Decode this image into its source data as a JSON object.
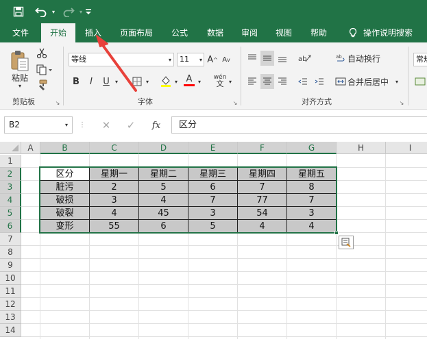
{
  "quick_access": {
    "save_icon": "save-icon",
    "undo_icon": "undo-icon",
    "redo_icon": "redo-icon",
    "customize_icon": "customize-qat-icon"
  },
  "menu": {
    "items": [
      "文件",
      "开始",
      "插入",
      "页面布局",
      "公式",
      "数据",
      "审阅",
      "视图",
      "帮助"
    ],
    "active": "开始",
    "tell_me": "操作说明搜索"
  },
  "ribbon": {
    "clipboard": {
      "paste_label": "粘贴",
      "group_label": "剪贴板"
    },
    "font": {
      "font_name": "等线",
      "font_size": "11",
      "bold": "B",
      "italic": "I",
      "underline": "U",
      "font_color": "A",
      "phonetic": "wén",
      "grow": "A",
      "shrink": "A",
      "group_label": "字体",
      "highlight_color": "#ffff00",
      "font_color_value": "#ff0000"
    },
    "alignment": {
      "wrap_text": "自动换行",
      "merge_center": "合并后居中",
      "group_label": "对齐方式"
    },
    "number": {
      "format": "常规"
    }
  },
  "formula_bar": {
    "name_box": "B2",
    "fx": "fx",
    "content": "区分"
  },
  "sheet": {
    "columns": [
      "A",
      "B",
      "C",
      "D",
      "E",
      "F",
      "G",
      "H",
      "I"
    ],
    "selected_columns": [
      "B",
      "C",
      "D",
      "E",
      "F",
      "G"
    ],
    "rows": [
      "1",
      "2",
      "3",
      "4",
      "5",
      "6",
      "7",
      "8",
      "9",
      "10",
      "11",
      "12",
      "13",
      "14"
    ],
    "selected_rows": [
      "2",
      "3",
      "4",
      "5",
      "6"
    ],
    "table": {
      "header": [
        "区分",
        "星期一",
        "星期二",
        "星期三",
        "星期四",
        "星期五"
      ],
      "rows": [
        [
          "脏污",
          "2",
          "5",
          "6",
          "7",
          "8"
        ],
        [
          "破损",
          "3",
          "4",
          "7",
          "77",
          "7"
        ],
        [
          "破裂",
          "4",
          "45",
          "3",
          "54",
          "3"
        ],
        [
          "变形",
          "55",
          "6",
          "5",
          "4",
          "4"
        ]
      ]
    }
  },
  "colors": {
    "excel_green": "#217346",
    "selection_gray": "#c8c8c8",
    "arrow_red": "#e8413a"
  }
}
